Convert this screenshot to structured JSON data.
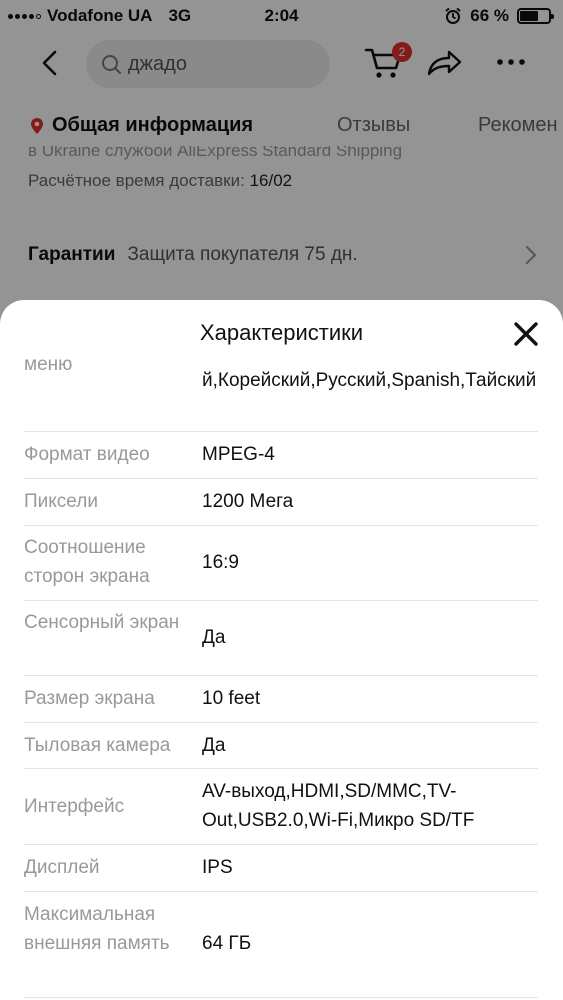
{
  "status_bar": {
    "carrier": "Vodafone UA",
    "network": "3G",
    "time": "2:04",
    "battery": "66 %",
    "battery_level": 0.66,
    "signal_bars": 5,
    "signal_active": 4
  },
  "nav": {
    "search_text": "джадо",
    "cart_count": "2",
    "icons": [
      "back-icon",
      "search-icon",
      "cart-icon",
      "share-icon",
      "more-icon"
    ]
  },
  "tabs": [
    {
      "label": "Общая информация",
      "active": true
    },
    {
      "label": "Отзывы",
      "active": false
    },
    {
      "label": "Рекомен",
      "active": false
    }
  ],
  "delivery": {
    "partial_line": "в Ukraine службой AliExpress Standard Shipping",
    "eta_label": "Расчётное время доставки:",
    "eta_value": "16/02"
  },
  "guarantee": {
    "title": "Гарантии",
    "text": "Защита покупателя 75 дн."
  },
  "sheet": {
    "title": "Характеристики",
    "specs": [
      {
        "label": "меню",
        "value": "й,Корейский,Русский,Spanish,Тайский"
      },
      {
        "label": "Формат видео",
        "value": "MPEG-4"
      },
      {
        "label": "Пиксели",
        "value": "1200 Мега"
      },
      {
        "label": "Соотношение сторон экрана",
        "value": "16:9"
      },
      {
        "label": "Сенсорный экран",
        "value": "Да"
      },
      {
        "label": "Размер экрана",
        "value": "10 feet"
      },
      {
        "label": "Тыловая камера",
        "value": "Да"
      },
      {
        "label": "Интерфейс",
        "value": "AV-выход,HDMI,SD/MMC,TV-Out,USB2.0,Wi-Fi,Микро SD/TF"
      },
      {
        "label": "Дисплей",
        "value": "IPS"
      },
      {
        "label": "Максимальная внешняя память",
        "value": "64 ГБ"
      }
    ]
  },
  "colors": {
    "accent": "#e62e2e",
    "label_gray": "#999999",
    "overlay": "#000000"
  }
}
